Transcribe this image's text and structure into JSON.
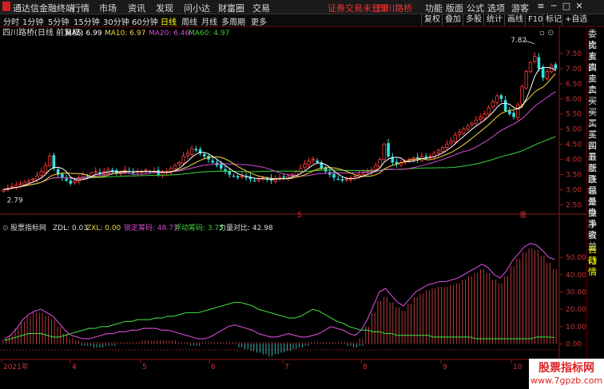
{
  "menubar": {
    "app_name": "通达信金融终端",
    "menus": [
      "行情",
      "市场",
      "资讯",
      "发现",
      "问小达",
      "财富圈",
      "交易"
    ],
    "login_warning": "证券交易未登录",
    "stock_name": "四川路桥",
    "right_items": [
      "功能",
      "版面",
      "公式",
      "选项"
    ],
    "user": "游客"
  },
  "periodbar": {
    "periods": [
      "分时",
      "1分钟",
      "5分钟",
      "15分钟",
      "30分钟",
      "60分钟",
      "日线",
      "周线",
      "月线",
      "多周期",
      "更多"
    ],
    "active_period": "日线",
    "tools": [
      "复权",
      "叠加",
      "多股",
      "统计",
      "画线",
      "F10",
      "标记",
      "+自选"
    ]
  },
  "main_chart": {
    "title": "四川路桥(日线 前复权)",
    "ma_labels": [
      {
        "text": "MA5: 6.99",
        "color": "#ffffff"
      },
      {
        "text": "MA10: 6.97",
        "color": "#f5d742"
      },
      {
        "text": "MA20: 6.46",
        "color": "#d24bd2"
      },
      {
        "text": "MA60: 4.97",
        "color": "#3bd23b"
      }
    ],
    "high_label": "7.82",
    "low_label": "2.79",
    "markers": [
      "5",
      "涨"
    ]
  },
  "indicator_panel": {
    "name": "股票指标网",
    "labels": [
      {
        "text": "ZDL: 0.03",
        "color": "#dddddd"
      },
      {
        "text": "ZXL: 0.00",
        "color": "#f5d742"
      },
      {
        "text": "锁定筹码: 48.73",
        "color": "#d24bd2"
      },
      {
        "text": "浮动筹码: 3.75",
        "color": "#3bd23b"
      },
      {
        "text": "力量对比: 42.98",
        "color": "#dddddd"
      }
    ]
  },
  "right_panel": {
    "items": [
      "委比",
      "卖五",
      "卖四",
      "卖三",
      "卖二",
      "卖一",
      "买一",
      "买二",
      "买三",
      "买四",
      "买五",
      "最新",
      "涨跌",
      "涨幅",
      "总量",
      "外盘",
      "换手",
      "净资",
      "收益"
    ],
    "bottom_items": [
      "自动",
      "行情"
    ]
  },
  "watermark": {
    "line1": "股票指标网",
    "line2": "www.7gpzb.com"
  },
  "chart_data": [
    {
      "type": "candlestick",
      "title": "四川路桥(日线 前复权)",
      "y_ticks": [
        "7.50",
        "7.00",
        "6.50",
        "6.00",
        "5.50",
        "5.00",
        "4.50",
        "4.00",
        "3.50",
        "3.00",
        "2.50"
      ],
      "ylim": [
        2.3,
        8.0
      ],
      "x_ticks": [
        "2021年",
        "4",
        "5",
        "6",
        "7",
        "8",
        "9",
        "10"
      ],
      "close_approx": [
        3.0,
        3.05,
        3.1,
        3.15,
        3.2,
        3.25,
        3.3,
        3.35,
        3.45,
        3.6,
        3.8,
        4.1,
        3.7,
        3.5,
        3.4,
        3.3,
        3.2,
        3.3,
        3.4,
        3.5,
        3.45,
        3.55,
        3.6,
        3.55,
        3.6,
        3.65,
        3.6,
        3.55,
        3.6,
        3.65,
        3.6,
        3.55,
        3.6,
        3.6,
        3.65,
        3.6,
        3.6,
        3.5,
        3.55,
        3.6,
        3.7,
        3.8,
        3.9,
        4.1,
        4.2,
        4.35,
        4.3,
        4.2,
        4.1,
        4.0,
        3.9,
        3.8,
        3.7,
        3.6,
        3.5,
        3.45,
        3.4,
        3.45,
        3.4,
        3.35,
        3.3,
        3.35,
        3.4,
        3.35,
        3.3,
        3.35,
        3.4,
        3.4,
        3.45,
        3.5,
        3.6,
        3.7,
        3.85,
        3.95,
        4.0,
        3.9,
        3.7,
        3.6,
        3.5,
        3.4,
        3.35,
        3.3,
        3.35,
        3.4,
        3.45,
        3.5,
        3.55,
        3.6,
        3.65,
        3.8,
        4.0,
        4.5,
        4.1,
        3.9,
        3.85,
        3.9,
        3.95,
        4.0,
        4.05,
        4.0,
        4.1,
        4.05,
        4.1,
        4.2,
        4.3,
        4.4,
        4.5,
        4.6,
        4.8,
        4.9,
        5.0,
        5.1,
        5.2,
        5.3,
        5.4,
        5.5,
        5.7,
        5.9,
        6.1,
        6.0,
        5.6,
        5.5,
        5.4,
        5.8,
        6.4,
        6.9,
        7.2,
        7.4,
        7.0,
        6.7,
        6.9,
        7.1,
        6.99
      ],
      "ma_latest": {
        "MA5": 6.99,
        "MA10": 6.97,
        "MA20": 6.46,
        "MA60": 4.97
      },
      "high": 7.82,
      "low": 2.79
    },
    {
      "type": "area",
      "title": "股票指标网",
      "y_ticks": [
        "50.00",
        "40.00",
        "30.00",
        "20.00",
        "10.00",
        "0.00"
      ],
      "ylim": [
        -8,
        62
      ],
      "series": [
        {
          "name": "锁定筹码",
          "color": "#d24bd2",
          "values": [
            3,
            5,
            9,
            14,
            17,
            19,
            20,
            18,
            16,
            12,
            8,
            5,
            4,
            3,
            3,
            4,
            5,
            6,
            6,
            7,
            7,
            8,
            8,
            9,
            9,
            9,
            8,
            8,
            7,
            6,
            5,
            4,
            3,
            3,
            4,
            6,
            8,
            10,
            11,
            10,
            9,
            8,
            6,
            5,
            4,
            4,
            5,
            6,
            5,
            4,
            4,
            5,
            6,
            8,
            10,
            9,
            8,
            6,
            5,
            8,
            14,
            22,
            30,
            32,
            28,
            24,
            22,
            26,
            30,
            32,
            34,
            35,
            36,
            36,
            37,
            38,
            40,
            42,
            44,
            46,
            44,
            40,
            38,
            42,
            48,
            52,
            56,
            58,
            57,
            54,
            50,
            48.73
          ]
        },
        {
          "name": "浮动筹码",
          "color": "#3bd23b",
          "values": [
            2,
            3,
            4,
            5,
            6,
            6,
            6,
            5,
            4,
            4,
            5,
            6,
            7,
            8,
            9,
            9,
            10,
            10,
            11,
            12,
            13,
            13,
            14,
            14,
            14,
            15,
            15,
            16,
            16,
            17,
            18,
            18,
            18,
            19,
            20,
            21,
            22,
            23,
            24,
            24,
            23,
            22,
            20,
            19,
            18,
            17,
            16,
            15,
            15,
            16,
            18,
            20,
            19,
            17,
            15,
            13,
            12,
            10,
            9,
            8,
            8,
            7,
            7,
            6,
            6,
            5,
            5,
            5,
            5,
            5,
            5,
            4,
            4,
            4,
            4,
            4,
            4,
            4,
            3,
            3,
            3,
            3,
            3,
            3,
            3,
            3,
            3,
            3,
            4,
            4,
            4,
            3.75
          ]
        },
        {
          "name": "力量对比",
          "color": "#e34848",
          "values": [
            3,
            5,
            9,
            13,
            16,
            18,
            18,
            16,
            14,
            10,
            6,
            3,
            2,
            1,
            1,
            1,
            1,
            1,
            1,
            1,
            1,
            1,
            1,
            2,
            2,
            2,
            2,
            2,
            2,
            1,
            1,
            1,
            1,
            1,
            1,
            1,
            1,
            1,
            1,
            1,
            1,
            1,
            1,
            1,
            1,
            1,
            1,
            1,
            1,
            1,
            1,
            1,
            1,
            1,
            1,
            1,
            1,
            1,
            1,
            3,
            10,
            18,
            25,
            27,
            24,
            21,
            19,
            23,
            27,
            29,
            31,
            32,
            33,
            33,
            34,
            35,
            37,
            39,
            41,
            43,
            41,
            37,
            35,
            39,
            45,
            49,
            53,
            55,
            54,
            51,
            47,
            42.98
          ]
        },
        {
          "name": "ZDL",
          "color": "#4ad8d8",
          "values": [
            0,
            0,
            0,
            0,
            0,
            0,
            0,
            0,
            0,
            0,
            0,
            0,
            0,
            -1,
            -1,
            -2,
            -2,
            -1,
            -1,
            0,
            0,
            0,
            0,
            0,
            0,
            0,
            0,
            0,
            0,
            0,
            0,
            -1,
            -1,
            0,
            0,
            0,
            0,
            0,
            0,
            -2,
            -3,
            -4,
            -5,
            -6,
            -7,
            -6,
            -5,
            -4,
            -3,
            -2,
            -1,
            0,
            0,
            0,
            0,
            0,
            0,
            -1,
            -2,
            -1,
            0,
            0,
            0,
            0,
            0,
            0,
            0,
            0,
            0,
            0,
            0,
            0,
            0,
            0,
            0,
            0,
            0,
            0,
            0,
            0,
            0,
            0,
            0,
            0,
            0,
            0,
            0,
            0,
            0,
            0,
            0,
            0.03
          ]
        }
      ]
    }
  ]
}
